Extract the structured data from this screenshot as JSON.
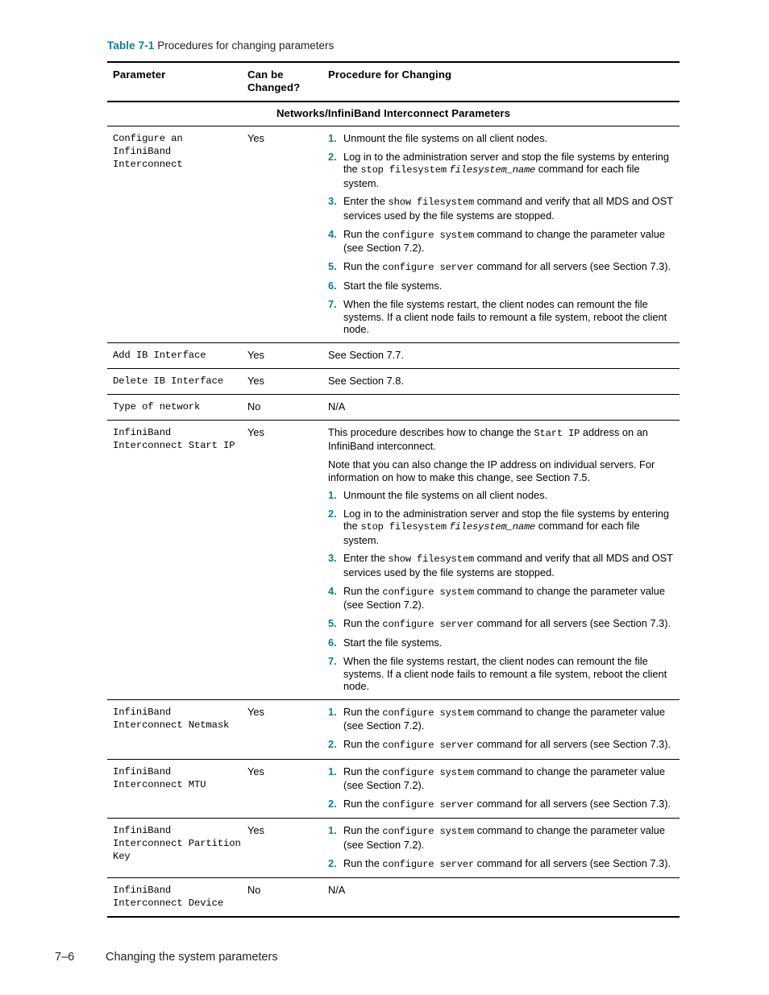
{
  "caption": {
    "label": "Table 7-1",
    "text": "Procedures for changing parameters",
    "accent_color": "#0d7f8e"
  },
  "table": {
    "columns": [
      "Parameter",
      "Can be Changed?",
      "Procedure for Changing"
    ],
    "headers": {
      "parameter": "Parameter",
      "can_be_changed_line1": "Can be",
      "can_be_changed_line2": "Changed?",
      "procedure": "Procedure for Changing"
    },
    "section_header": "Networks/InfiniBand Interconnect Parameters",
    "rows": [
      {
        "parameter": "Configure an InfiniBand Interconnect",
        "can_be_changed": "Yes",
        "intro": [],
        "steps": [
          {
            "n": "1.",
            "html": "Unmount the file systems on all client nodes."
          },
          {
            "n": "2.",
            "html": "Log in to the administration server and stop the file systems by entering the <code>stop filesystem</code> <span class=\"mono-i\">filesystem_name</span> command for each file system."
          },
          {
            "n": "3.",
            "html": "Enter the <code>show filesystem</code> command and verify that all MDS and OST services used by the file systems are stopped."
          },
          {
            "n": "4.",
            "html": "Run the <code>configure system</code> command to change the parameter value (see Section 7.2)."
          },
          {
            "n": "5.",
            "html": "Run the <code>configure server</code> command for all servers (see Section 7.3)."
          },
          {
            "n": "6.",
            "html": "Start the file systems."
          },
          {
            "n": "7.",
            "html": "When the file systems restart, the client nodes can remount the file systems. If a client node fails to remount a file system, reboot the client node."
          }
        ],
        "plain": null
      },
      {
        "parameter": "Add IB Interface",
        "can_be_changed": "Yes",
        "intro": [],
        "steps": [],
        "plain": "See Section 7.7."
      },
      {
        "parameter": "Delete IB Interface",
        "can_be_changed": "Yes",
        "intro": [],
        "steps": [],
        "plain": "See Section 7.8."
      },
      {
        "parameter": "Type of network",
        "can_be_changed": "No",
        "intro": [],
        "steps": [],
        "plain": "N/A"
      },
      {
        "parameter": "InfiniBand Interconnect Start IP",
        "can_be_changed": "Yes",
        "intro": [
          "This procedure describes how to change the <code>Start IP</code> address on an InfiniBand interconnect.",
          "Note that you can also change the IP address on individual servers. For information on how to make this change, see Section 7.5."
        ],
        "steps": [
          {
            "n": "1.",
            "html": "Unmount the file systems on all client nodes."
          },
          {
            "n": "2.",
            "html": "Log in to the administration server and stop the file systems by entering the <code>stop filesystem</code> <span class=\"mono-i\">filesystem_name</span> command for each file system."
          },
          {
            "n": "3.",
            "html": "Enter the <code>show filesystem</code> command and verify that all MDS and OST services used by the file systems are stopped."
          },
          {
            "n": "4.",
            "html": "Run the <code>configure system</code> command to change the parameter value (see Section 7.2)."
          },
          {
            "n": "5.",
            "html": "Run the <code>configure server</code> command for all servers (see Section 7.3)."
          },
          {
            "n": "6.",
            "html": "Start the file systems."
          },
          {
            "n": "7.",
            "html": "When the file systems restart, the client nodes can remount the file systems. If a client node fails to remount a file system, reboot the client node."
          }
        ],
        "plain": null
      },
      {
        "parameter": "InfiniBand Interconnect Netmask",
        "can_be_changed": "Yes",
        "intro": [],
        "steps": [
          {
            "n": "1.",
            "html": "Run the <code>configure system</code> command to change the parameter value (see Section 7.2)."
          },
          {
            "n": "2.",
            "html": "Run the <code>configure server</code> command for all servers (see Section 7.3)."
          }
        ],
        "plain": null
      },
      {
        "parameter": "InfiniBand Interconnect MTU",
        "can_be_changed": "Yes",
        "intro": [],
        "steps": [
          {
            "n": "1.",
            "html": "Run the <code>configure system</code> command to change the parameter value (see Section 7.2)."
          },
          {
            "n": "2.",
            "html": "Run the <code>configure server</code> command for all servers (see Section 7.3)."
          }
        ],
        "plain": null
      },
      {
        "parameter": "InfiniBand Interconnect Partition Key",
        "can_be_changed": "Yes",
        "intro": [],
        "steps": [
          {
            "n": "1.",
            "html": "Run the <code>configure system</code> command to change the parameter value (see Section 7.2)."
          },
          {
            "n": "2.",
            "html": "Run the <code>configure server</code> command for all servers (see Section 7.3)."
          }
        ],
        "plain": null
      },
      {
        "parameter": "InfiniBand Interconnect Device",
        "can_be_changed": "No",
        "intro": [],
        "steps": [],
        "plain": "N/A"
      }
    ]
  },
  "footer": {
    "page_number": "7–6",
    "chapter_title": "Changing the system parameters"
  }
}
